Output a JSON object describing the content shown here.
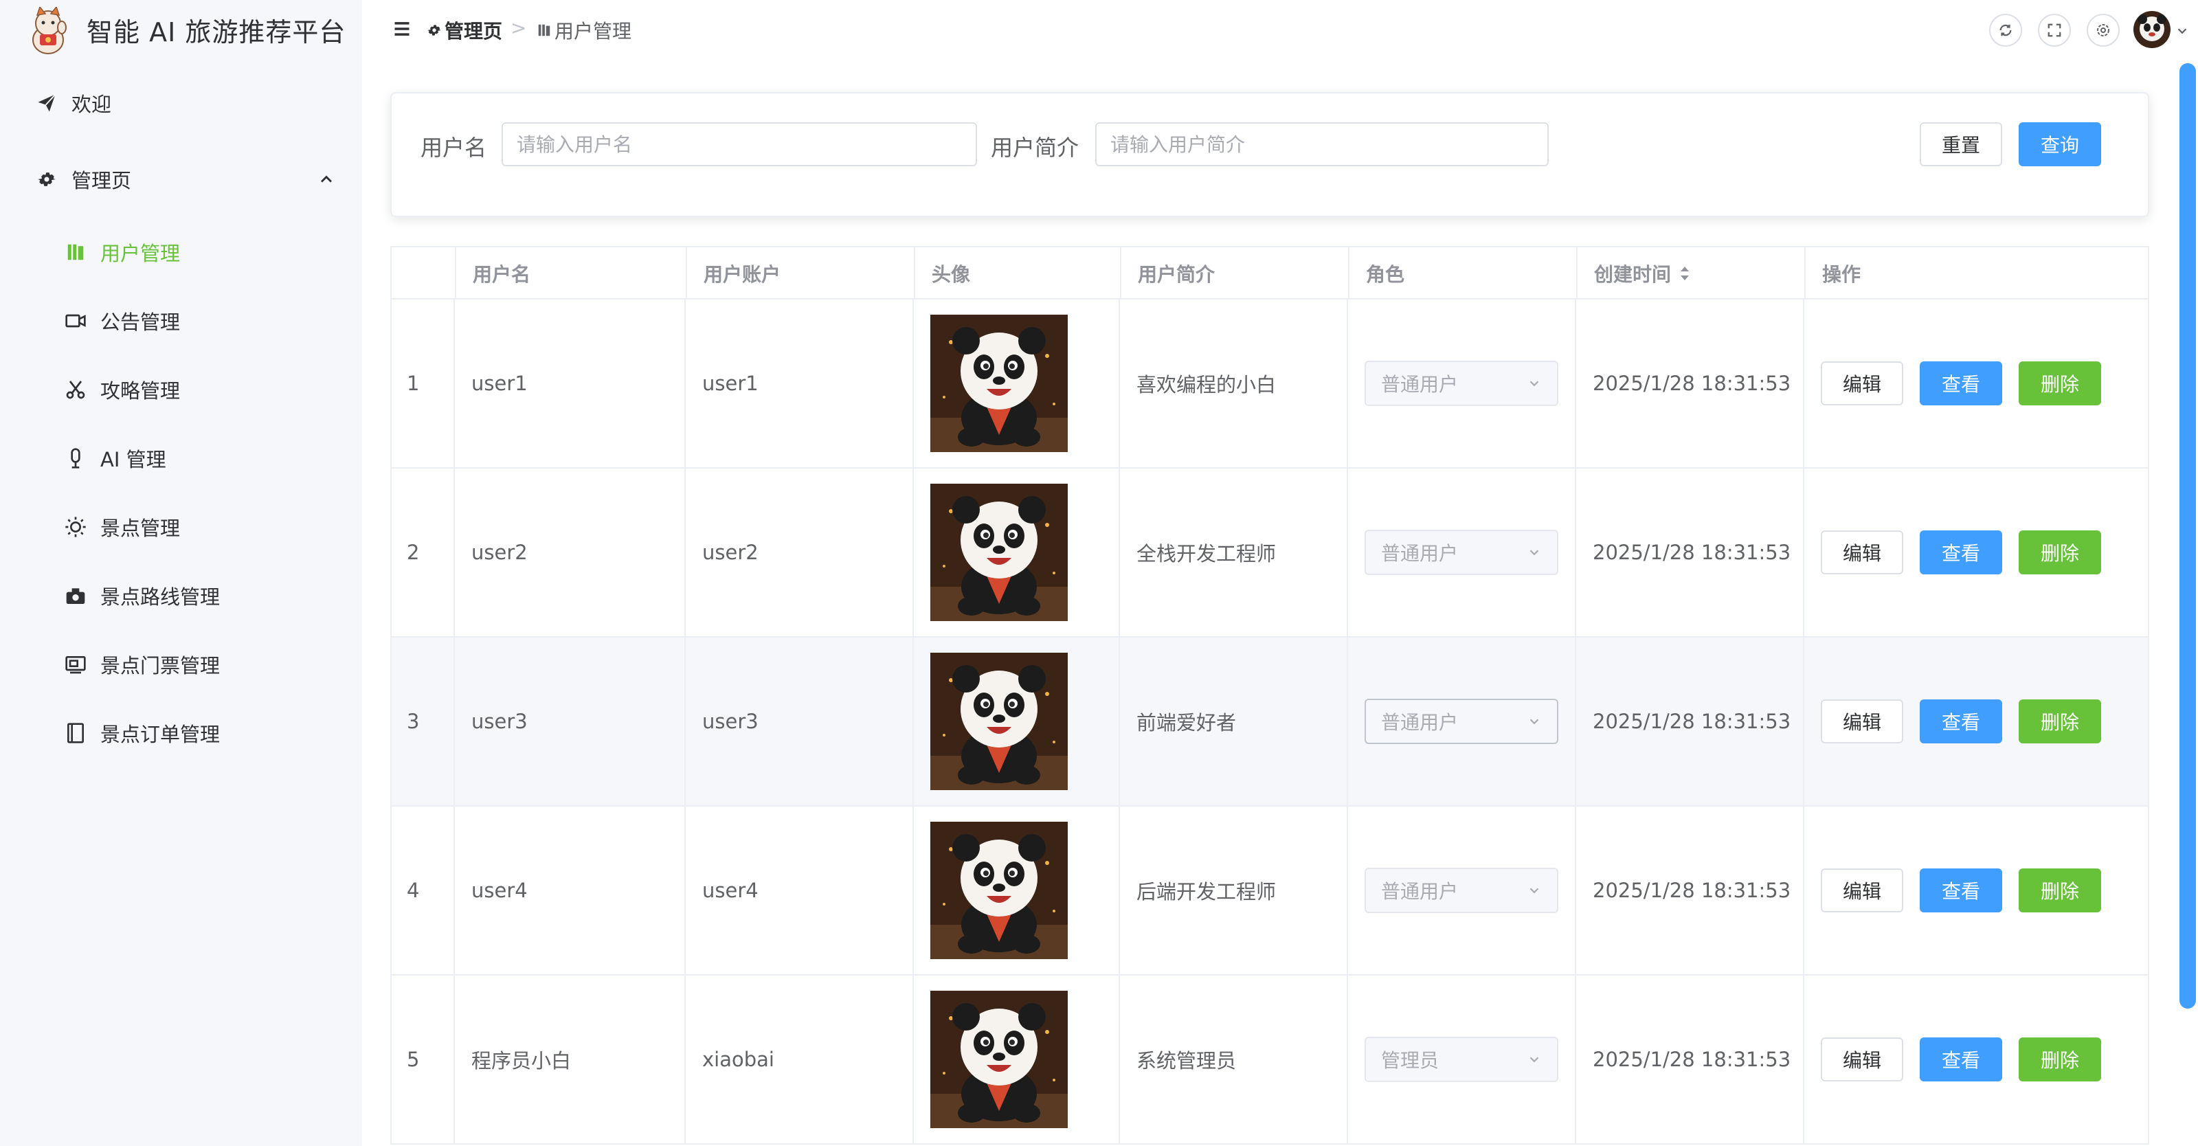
{
  "sidebar": {
    "app_title": "智能 AI 旅游推荐平台",
    "items": [
      {
        "label": "欢迎",
        "icon": "paper-plane-icon"
      },
      {
        "label": "管理页",
        "icon": "gear-icon"
      },
      {
        "label": "用户管理",
        "icon": "user-list-icon"
      },
      {
        "label": "公告管理",
        "icon": "video-camera-icon"
      },
      {
        "label": "攻略管理",
        "icon": "scissors-icon"
      },
      {
        "label": "AI 管理",
        "icon": "microphone-icon"
      },
      {
        "label": "景点管理",
        "icon": "sun-icon"
      },
      {
        "label": "景点路线管理",
        "icon": "camera-icon"
      },
      {
        "label": "景点门票管理",
        "icon": "ticket-icon"
      },
      {
        "label": "景点订单管理",
        "icon": "notebook-icon"
      }
    ],
    "active_color": "#67c23a"
  },
  "header": {
    "breadcrumb": [
      {
        "label": "管理页",
        "icon": "gear-icon"
      },
      {
        "label": "用户管理",
        "icon": "user-list-icon"
      }
    ],
    "separator": ">",
    "actions": [
      "refresh-icon",
      "fullscreen-icon",
      "settings-icon"
    ]
  },
  "search": {
    "username_label": "用户名",
    "username_placeholder": "请输入用户名",
    "profile_label": "用户简介",
    "profile_placeholder": "请输入用户简介",
    "reset_label": "重置",
    "query_label": "查询"
  },
  "table": {
    "columns": [
      "",
      "用户名",
      "用户账户",
      "头像",
      "用户简介",
      "角色",
      "创建时间",
      "操作"
    ],
    "rows": [
      {
        "index": "1",
        "username": "user1",
        "account": "user1",
        "profile": "喜欢编程的小白",
        "role": "普通用户",
        "created": "2025/1/28 18:31:53"
      },
      {
        "index": "2",
        "username": "user2",
        "account": "user2",
        "profile": "全栈开发工程师",
        "role": "普通用户",
        "created": "2025/1/28 18:31:53"
      },
      {
        "index": "3",
        "username": "user3",
        "account": "user3",
        "profile": "前端爱好者",
        "role": "普通用户",
        "created": "2025/1/28 18:31:53"
      },
      {
        "index": "4",
        "username": "user4",
        "account": "user4",
        "profile": "后端开发工程师",
        "role": "普通用户",
        "created": "2025/1/28 18:31:53"
      },
      {
        "index": "5",
        "username": "程序员小白",
        "account": "xiaobai",
        "profile": "系统管理员",
        "role": "管理员",
        "created": "2025/1/28 18:31:53"
      }
    ],
    "actions": {
      "edit": "编辑",
      "view": "查看",
      "delete": "删除"
    }
  },
  "colors": {
    "primary": "#409eff",
    "success": "#67c23a",
    "border": "#ebeef5"
  }
}
